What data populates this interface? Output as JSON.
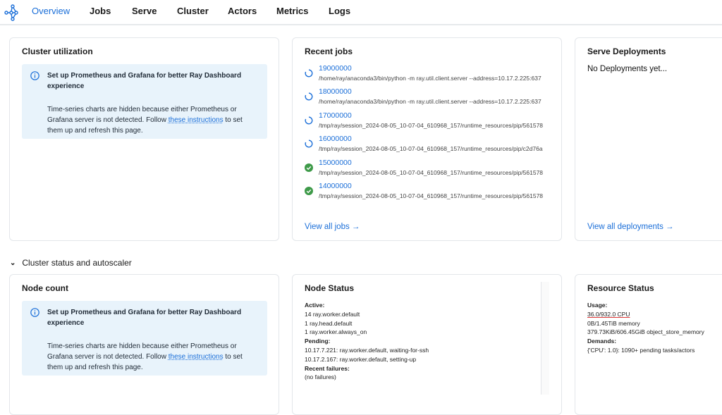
{
  "nav": {
    "tabs": [
      "Overview",
      "Jobs",
      "Serve",
      "Cluster",
      "Actors",
      "Metrics",
      "Logs"
    ],
    "active": "Overview"
  },
  "cluster_utilization": {
    "title": "Cluster utilization",
    "alert_title": "Set up Prometheus and Grafana for better Ray Dashboard experience",
    "alert_text_1": "Time-series charts are hidden because either Prometheus or Grafana server is not detected. Follow ",
    "alert_link": "these instructions",
    "alert_text_2": " to set them up and refresh this page."
  },
  "recent_jobs": {
    "title": "Recent jobs",
    "jobs": [
      {
        "id": "19000000",
        "cmd": "/home/ray/anaconda3/bin/python -m ray.util.client.server --address=10.17.2.225:637",
        "status": "running"
      },
      {
        "id": "18000000",
        "cmd": "/home/ray/anaconda3/bin/python -m ray.util.client.server --address=10.17.2.225:637",
        "status": "running"
      },
      {
        "id": "17000000",
        "cmd": "/tmp/ray/session_2024-08-05_10-07-04_610968_157/runtime_resources/pip/561578",
        "status": "running"
      },
      {
        "id": "16000000",
        "cmd": "/tmp/ray/session_2024-08-05_10-07-04_610968_157/runtime_resources/pip/c2d76a",
        "status": "running"
      },
      {
        "id": "15000000",
        "cmd": "/tmp/ray/session_2024-08-05_10-07-04_610968_157/runtime_resources/pip/561578",
        "status": "succeeded"
      },
      {
        "id": "14000000",
        "cmd": "/tmp/ray/session_2024-08-05_10-07-04_610968_157/runtime_resources/pip/561578",
        "status": "succeeded"
      }
    ],
    "view_all": "View all jobs"
  },
  "serve": {
    "title": "Serve Deployments",
    "empty": "No Deployments yet...",
    "view_all": "View all deployments"
  },
  "section": {
    "title": "Cluster status and autoscaler"
  },
  "node_count": {
    "title": "Node count",
    "alert_title": "Set up Prometheus and Grafana for better Ray Dashboard experience",
    "alert_text_1": "Time-series charts are hidden because either Prometheus or Grafana server is not detected. Follow ",
    "alert_link": "these instructions",
    "alert_text_2": " to set them up and refresh this page."
  },
  "node_status": {
    "title": "Node Status",
    "active_label": "Active:",
    "active": [
      "14 ray.worker.default",
      "1 ray.head.default",
      "1 ray.worker.always_on"
    ],
    "pending_label": "Pending:",
    "pending": [
      "10.17.7.221: ray.worker.default, waiting-for-ssh",
      "10.17.2.167: ray.worker.default, setting-up"
    ],
    "failures_label": "Recent failures:",
    "failures": "(no failures)"
  },
  "resource_status": {
    "title": "Resource Status",
    "usage_label": "Usage:",
    "usage": [
      "36.0/932.0 CPU",
      "0B/1.45TiB memory",
      "379.73KiB/606.45GiB object_store_memory"
    ],
    "demands_label": "Demands:",
    "demands": "{'CPU': 1.0}: 1090+ pending tasks/actors"
  }
}
